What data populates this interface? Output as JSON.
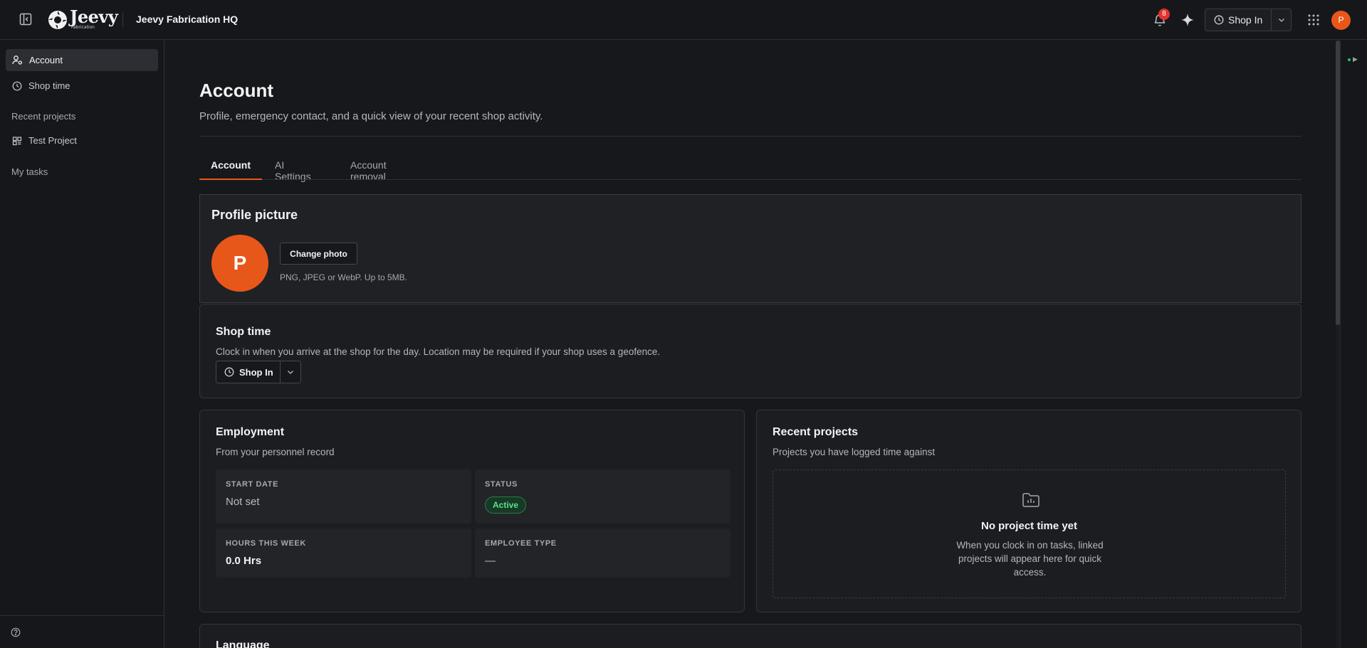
{
  "topbar": {
    "logo_text": "Jeevy",
    "logo_sub": "Fabrication",
    "workspace": "Jeevy Fabrication HQ",
    "notification_count": "8",
    "shop_in_label": "Shop In",
    "avatar_initial": "P"
  },
  "sidebar": {
    "items": [
      {
        "label": "Account",
        "icon": "user-gear-icon",
        "active": true
      },
      {
        "label": "Shop time",
        "icon": "clock-icon",
        "active": false
      }
    ],
    "recent_projects_heading": "Recent projects",
    "projects": [
      {
        "label": "Test Project",
        "icon": "board-icon"
      }
    ],
    "my_tasks_heading": "My tasks"
  },
  "page": {
    "title": "Account",
    "subtitle": "Profile, emergency contact, and a quick view of your recent shop activity.",
    "tabs": [
      {
        "label": "Account",
        "active": true
      },
      {
        "label": "AI Settings",
        "active": false
      },
      {
        "label": "Account removal",
        "active": false
      }
    ]
  },
  "profile_picture": {
    "title": "Profile picture",
    "avatar_initial": "P",
    "change_label": "Change photo",
    "hint": "PNG, JPEG or WebP. Up to 5MB."
  },
  "shop_time": {
    "title": "Shop time",
    "description": "Clock in when you arrive at the shop for the day. Location may be required if your shop uses a geofence.",
    "button_label": "Shop In"
  },
  "employment": {
    "title": "Employment",
    "description": "From your personnel record",
    "start_date_label": "START DATE",
    "start_date_value": "Not set",
    "status_label": "STATUS",
    "status_value": "Active",
    "hours_label": "HOURS THIS WEEK",
    "hours_value": "0.0 Hrs",
    "employee_type_label": "EMPLOYEE TYPE",
    "employee_type_value": "—"
  },
  "recent_projects": {
    "title": "Recent projects",
    "description": "Projects you have logged time against",
    "empty_title": "No project time yet",
    "empty_text": "When you clock in on tasks, linked projects will appear here for quick access."
  },
  "language": {
    "title": "Language"
  },
  "colors": {
    "accent": "#e8571a",
    "success": "#5fe08c",
    "badge": "#e3342f"
  }
}
